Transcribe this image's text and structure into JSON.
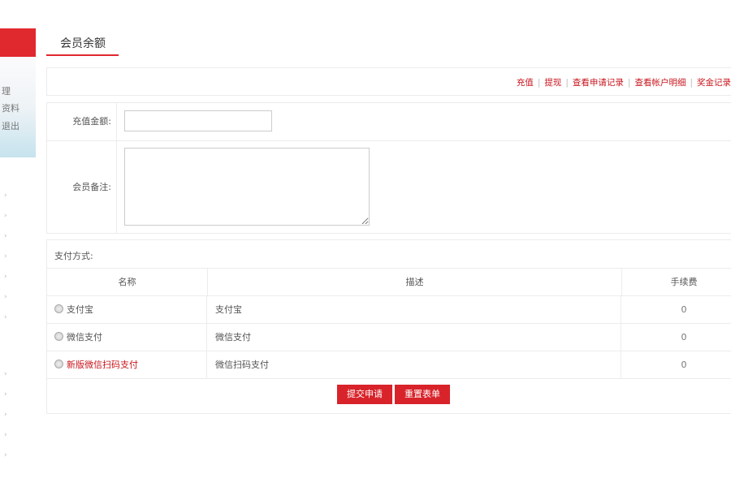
{
  "sidebar": {
    "menu_lines": [
      "理",
      "资料",
      "退出"
    ],
    "chevron": "›"
  },
  "tab": {
    "label": "会员余额"
  },
  "links": [
    {
      "label": "充值"
    },
    {
      "label": "提现"
    },
    {
      "label": "查看申请记录"
    },
    {
      "label": "查看帐户明细"
    },
    {
      "label": "奖金记录"
    }
  ],
  "form": {
    "amount_label": "充值金额:",
    "amount_value": "",
    "note_label": "会员备注:",
    "note_value": ""
  },
  "payment": {
    "title": "支付方式:",
    "columns": [
      "名称",
      "描述",
      "手续费"
    ],
    "rows": [
      {
        "name": "支付宝",
        "desc": "支付宝",
        "fee": "0",
        "highlight": false
      },
      {
        "name": "微信支付",
        "desc": "微信支付",
        "fee": "0",
        "highlight": false
      },
      {
        "name": "新版微信扫码支付",
        "desc": "微信扫码支付",
        "fee": "0",
        "highlight": true
      }
    ]
  },
  "buttons": {
    "submit": "提交申请",
    "reset": "重置表单"
  },
  "colors": {
    "accent": "#e0282f",
    "link": "#c8161d"
  }
}
